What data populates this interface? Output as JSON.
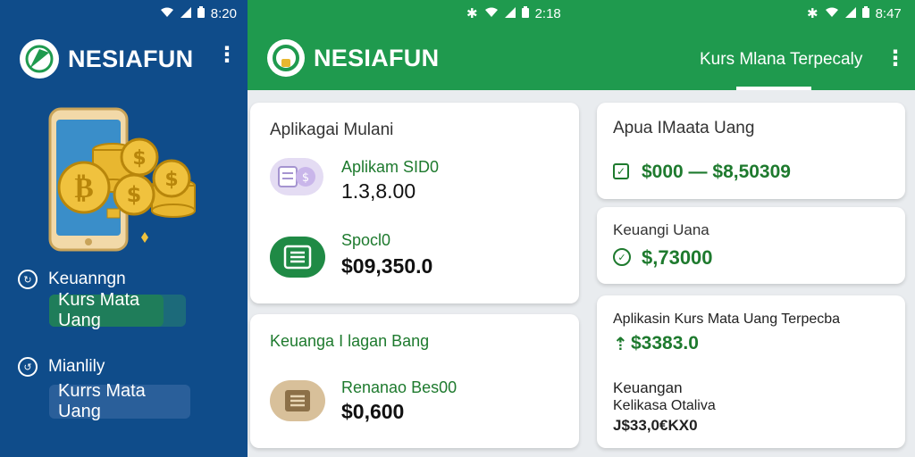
{
  "left_panel": {
    "status_time": "8:20",
    "brand": "NESIAFUN",
    "nav": [
      {
        "label": "Keuanngn",
        "pill": "Kurs Mata Uang"
      },
      {
        "label": "Mianlily",
        "pill": "Kurrs Mata Uang"
      }
    ]
  },
  "right_panel": {
    "status_time_1": "2:18",
    "status_time_2": "8:47",
    "brand": "NESIAFUN",
    "appbar_title": "Kurs Mlana Terpecaly"
  },
  "cards": {
    "c1": {
      "title": "Aplikagai Mulani",
      "item1_label": "Aplikam SID0",
      "item1_value": "1.3,8.00",
      "item2_label": "Spocl0",
      "item2_value": "$09,350.0"
    },
    "c2": {
      "title": "Keuanga I lagan Bang",
      "item_label": "Renanao Bes00",
      "item_value": "$0,600"
    },
    "c3": {
      "title": "Apua IMaata Uang",
      "value": "$000 — $8,50309"
    },
    "c4": {
      "title": "Keuangi Uana",
      "value": "$,73000"
    },
    "c5": {
      "title": "Aplikasin Kurs Mata Uang Terpecba",
      "value": "$3383.0",
      "line1": "Keuangan",
      "line2": "Kelikasa Otaliva",
      "line3": "J$33,0€KX0"
    }
  },
  "colors": {
    "left_bg": "#0f4c8a",
    "appbar": "#1f9a4e",
    "accent_green": "#1e7a2e",
    "card_bg": "#ffffff",
    "page_bg": "#e9ecef"
  }
}
